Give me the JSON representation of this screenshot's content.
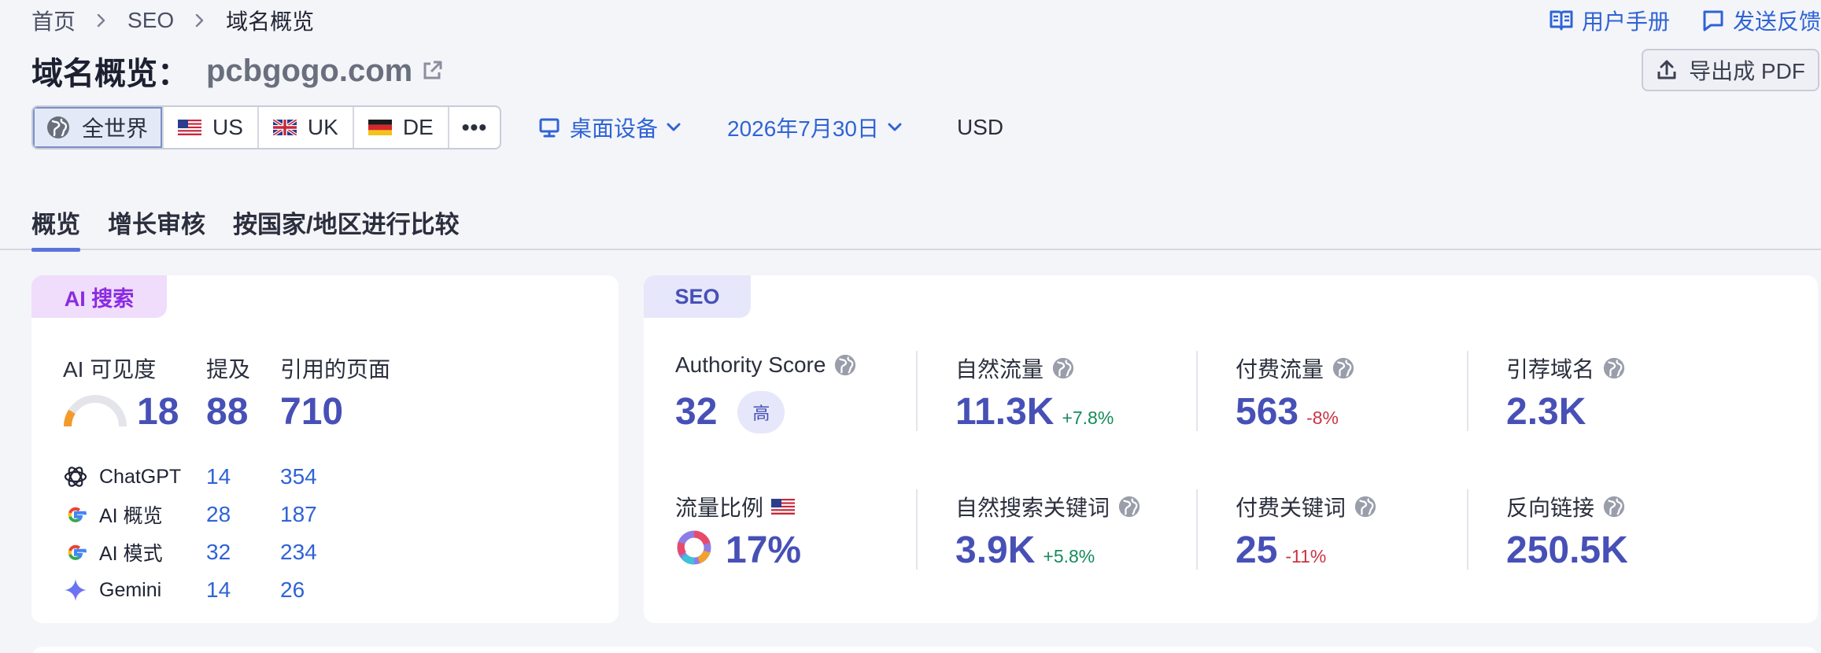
{
  "breadcrumb": {
    "home": "首页",
    "seo": "SEO",
    "current": "域名概览"
  },
  "top_links": {
    "manual": "用户手册",
    "feedback": "发送反馈"
  },
  "title": {
    "label": "域名概览：",
    "domain": "pcbgogo.com"
  },
  "export_label": "导出成 PDF",
  "databases": {
    "worldwide": "全世界",
    "us": "US",
    "uk": "UK",
    "de": "DE",
    "more": "•••"
  },
  "filters": {
    "device": "桌面设备",
    "date": "2026年7月30日",
    "currency": "USD"
  },
  "tabs": {
    "overview": "概览",
    "growth": "增长审核",
    "compare": "按国家/地区进行比较"
  },
  "ai_card": {
    "tag": "AI 搜索",
    "visibility_label": "AI 可见度",
    "mentions_label": "提及",
    "cited_label": "引用的页面",
    "visibility_value": "18",
    "visibility_fraction": 0.18,
    "mentions_value": "88",
    "cited_value": "710",
    "rows": [
      {
        "name": "ChatGPT",
        "mentions": "14",
        "cited": "354",
        "icon": "chatgpt-icon"
      },
      {
        "name": "AI 概览",
        "mentions": "28",
        "cited": "187",
        "icon": "google-icon"
      },
      {
        "name": "AI 模式",
        "mentions": "32",
        "cited": "234",
        "icon": "google-icon"
      },
      {
        "name": "Gemini",
        "mentions": "14",
        "cited": "26",
        "icon": "gemini-icon"
      }
    ]
  },
  "seo_card": {
    "tag": "SEO",
    "authority": {
      "label": "Authority Score",
      "value": "32",
      "badge": "高"
    },
    "organic_traffic": {
      "label": "自然流量",
      "value": "11.3K",
      "delta": "+7.8%"
    },
    "paid_traffic": {
      "label": "付费流量",
      "value": "563",
      "delta": "-8%"
    },
    "ref_domains": {
      "label": "引荐域名",
      "value": "2.3K"
    },
    "traffic_share": {
      "label": "流量比例",
      "value": "17%"
    },
    "organic_keywords": {
      "label": "自然搜索关键词",
      "value": "3.9K",
      "delta": "+5.8%"
    },
    "paid_keywords": {
      "label": "付费关键词",
      "value": "25",
      "delta": "-11%"
    },
    "backlinks": {
      "label": "反向链接",
      "value": "250.5K"
    }
  },
  "colors": {
    "accent": "#2f63d6",
    "metric": "#4750b6",
    "ai_tag_bg": "#f0dcfb",
    "ai_tag_text": "#8a2be2",
    "seo_tag_bg": "#e6e7fa",
    "positive": "#168a5b",
    "negative": "#cc3344"
  }
}
